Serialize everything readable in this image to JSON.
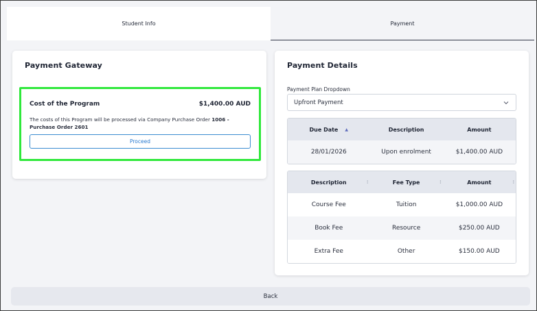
{
  "tabs": [
    {
      "label": "Student Info",
      "active": false
    },
    {
      "label": "Payment",
      "active": true
    }
  ],
  "gateway": {
    "title": "Payment Gateway",
    "cost_label": "Cost of the Program",
    "cost_value": "$1,400.00 AUD",
    "desc_prefix": "The costs of this Program will be processed via Company Purchase Order ",
    "desc_bold": "1006 - Purchase Order 2601",
    "proceed_label": "Proceed",
    "highlight_color": "#2ee83a"
  },
  "details": {
    "title": "Payment Details",
    "dropdown_label": "Payment Plan Dropdown",
    "dropdown_value": "Upfront Payment",
    "schedule": {
      "headers": [
        "Due Date",
        "Description",
        "Amount"
      ],
      "sort_icon": "sort-up-icon",
      "rows": [
        [
          "28/01/2026",
          "Upon enrolment",
          "$1,400.00 AUD"
        ]
      ]
    },
    "fees": {
      "headers": [
        "Description",
        "Fee Type",
        "Amount"
      ],
      "rows": [
        [
          "Course Fee",
          "Tuition",
          "$1,000.00 AUD"
        ],
        [
          "Book Fee",
          "Resource",
          "$250.00 AUD"
        ],
        [
          "Extra Fee",
          "Other",
          "$150.00 AUD"
        ]
      ]
    }
  },
  "back_label": "Back",
  "colors": {
    "accent_blue": "#2a7bd0",
    "page_bg": "#f3f4f7",
    "header_bg": "#e4e7ee"
  }
}
